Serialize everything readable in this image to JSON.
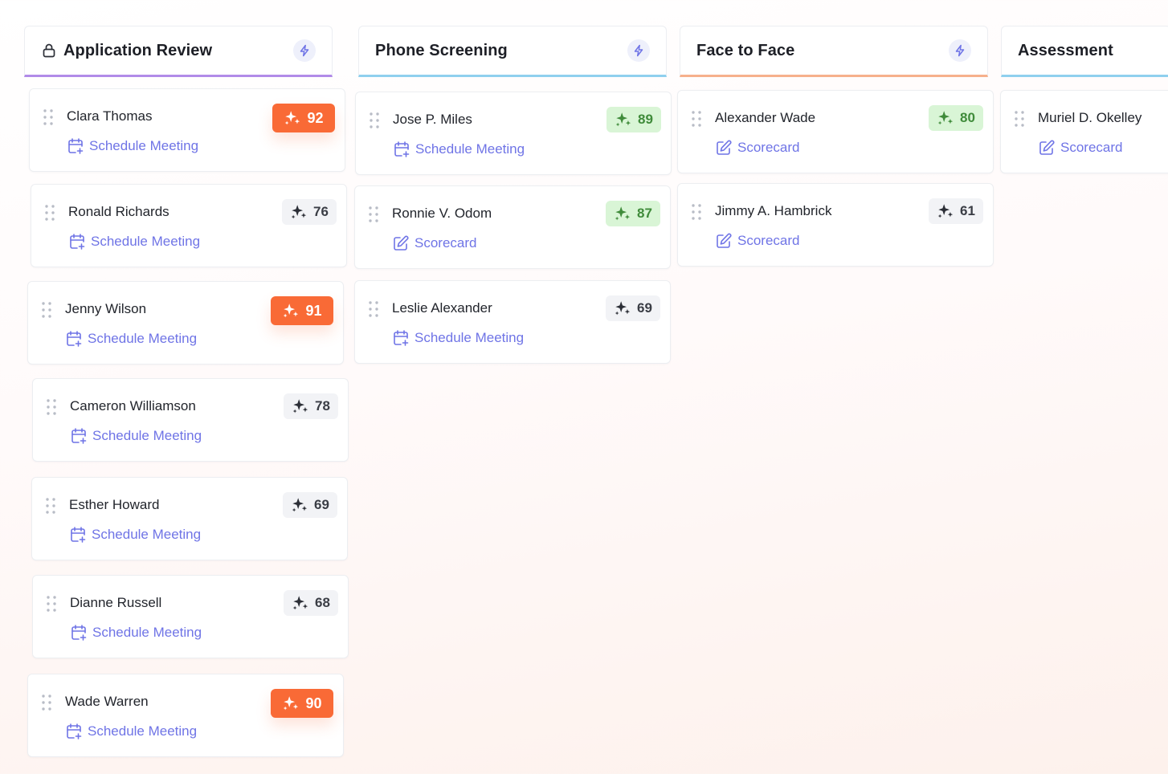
{
  "colors": {
    "accent": "#6f74e6",
    "hot_badge": "#f96a36",
    "good_badge": "#d9f5d6",
    "normal_badge": "#f2f3f6"
  },
  "columns": [
    {
      "title": "Application Review",
      "underline_color": "#b18be8",
      "icons": [
        "lock-icon",
        "bolt-icon"
      ],
      "cards": [
        {
          "name": "Clara Thomas",
          "score": "92",
          "score_level": "hot",
          "action": "Schedule Meeting",
          "action_icon": "calendar-add-icon"
        },
        {
          "name": "Ronald Richards",
          "score": "76",
          "score_level": "normal",
          "action": "Schedule Meeting",
          "action_icon": "calendar-add-icon"
        },
        {
          "name": "Jenny Wilson",
          "score": "91",
          "score_level": "hot",
          "action": "Schedule Meeting",
          "action_icon": "calendar-add-icon"
        },
        {
          "name": "Cameron Williamson",
          "score": "78",
          "score_level": "normal",
          "action": "Schedule Meeting",
          "action_icon": "calendar-add-icon"
        },
        {
          "name": "Esther Howard",
          "score": "69",
          "score_level": "normal",
          "action": "Schedule Meeting",
          "action_icon": "calendar-add-icon"
        },
        {
          "name": "Dianne Russell",
          "score": "68",
          "score_level": "normal",
          "action": "Schedule Meeting",
          "action_icon": "calendar-add-icon"
        },
        {
          "name": "Wade Warren",
          "score": "90",
          "score_level": "hot",
          "action": "Schedule Meeting",
          "action_icon": "calendar-add-icon"
        }
      ]
    },
    {
      "title": "Phone Screening",
      "underline_color": "#8fd0ee",
      "icons": [
        "bolt-icon"
      ],
      "cards": [
        {
          "name": "Jose P. Miles",
          "score": "89",
          "score_level": "good",
          "action": "Schedule Meeting",
          "action_icon": "calendar-add-icon"
        },
        {
          "name": "Ronnie V. Odom",
          "score": "87",
          "score_level": "good",
          "action": "Scorecard",
          "action_icon": "edit-icon"
        },
        {
          "name": "Leslie Alexander",
          "score": "69",
          "score_level": "normal",
          "action": "Schedule Meeting",
          "action_icon": "calendar-add-icon"
        }
      ]
    },
    {
      "title": "Face to Face",
      "underline_color": "#f6b08c",
      "icons": [
        "bolt-icon"
      ],
      "cards": [
        {
          "name": "Alexander Wade",
          "score": "80",
          "score_level": "good",
          "action": "Scorecard",
          "action_icon": "edit-icon"
        },
        {
          "name": "Jimmy A. Hambrick",
          "score": "61",
          "score_level": "normal",
          "action": "Scorecard",
          "action_icon": "edit-icon"
        }
      ]
    },
    {
      "title": "Assessment",
      "underline_color": "#8fd0ee",
      "icons": [],
      "cards": [
        {
          "name": "Muriel D. Okelley",
          "score": "",
          "score_level": "none",
          "action": "Scorecard",
          "action_icon": "edit-icon"
        }
      ]
    }
  ]
}
